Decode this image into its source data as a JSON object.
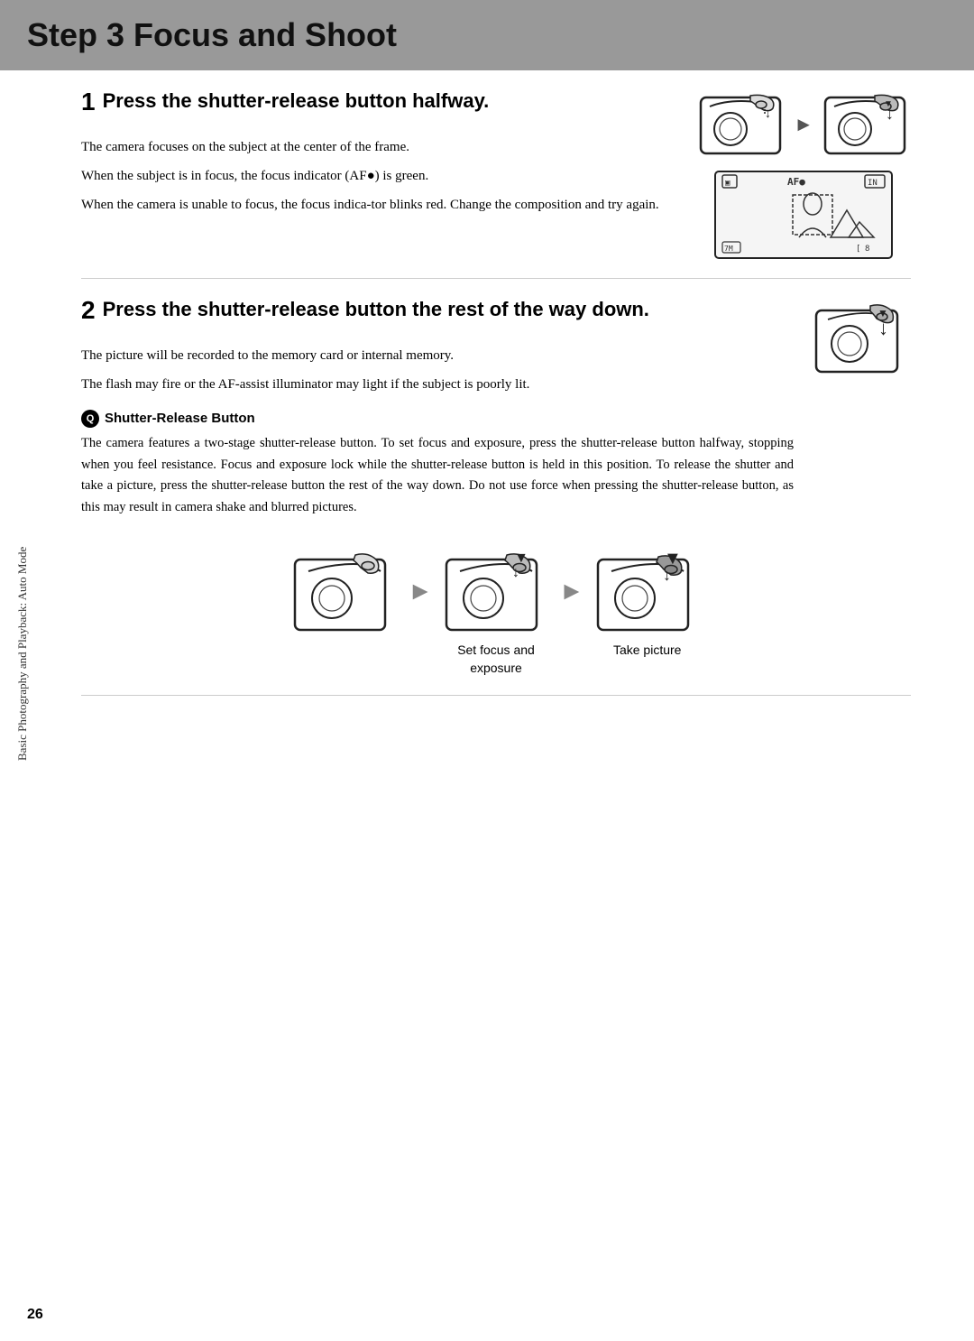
{
  "header": {
    "title": "Step 3 Focus and Shoot"
  },
  "sidebar_label": "Basic Photography and Playback: Auto Mode",
  "page_number": "26",
  "step1": {
    "number": "1",
    "heading": "Press the shutter-release button halfway.",
    "paragraphs": [
      "The camera focuses on the subject at the center of the frame.",
      "When the subject is in focus, the focus indicator (AF●) is green.",
      "When the camera is unable to focus, the focus indica-tor blinks red. Change the composition and try again."
    ]
  },
  "step2": {
    "number": "2",
    "heading": "Press the shutter-release button the rest of the way down.",
    "paragraphs": [
      "The picture will be recorded to the memory card or internal memory.",
      "The flash may fire or the AF-assist illuminator may light if the subject is poorly lit."
    ],
    "shutter_note_title": "Shutter-Release Button",
    "shutter_note_body": "The camera features a two-stage shutter-release button. To set focus and exposure, press the shutter-release button halfway, stopping when you feel resistance. Focus and exposure lock while the shutter-release button is held in this position. To release the shutter and take a picture, press the shutter-release button the rest of the way down. Do not use force when pressing the shutter-release button, as this may result in camera shake and blurred pictures."
  },
  "illustrations": {
    "label1": "Set focus and\nexposure",
    "label2": "Take picture"
  }
}
